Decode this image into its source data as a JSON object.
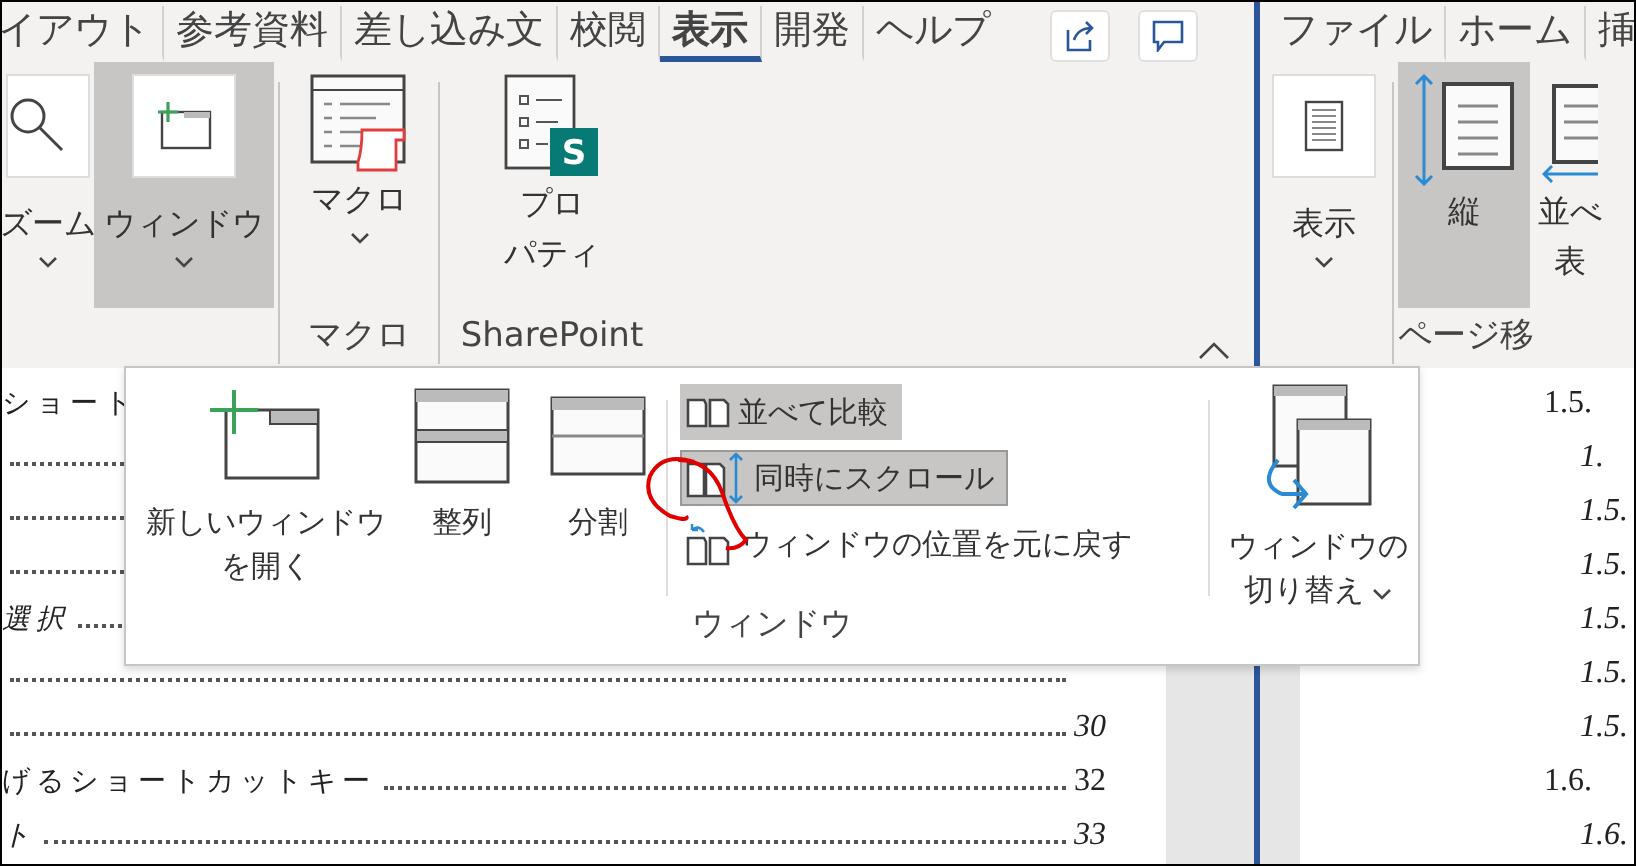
{
  "left_window": {
    "tabs": [
      {
        "label": "イアウト",
        "selected": false
      },
      {
        "label": "参考資料",
        "selected": false
      },
      {
        "label": "差し込み文",
        "selected": false
      },
      {
        "label": "校閲",
        "selected": false
      },
      {
        "label": "表示",
        "selected": true
      },
      {
        "label": "開発",
        "selected": false
      },
      {
        "label": "ヘルプ",
        "selected": false
      }
    ],
    "ribbon": {
      "buttons": [
        {
          "kind": "zoom",
          "lines": [
            "ズーム"
          ],
          "selected": false,
          "dropdown": true
        },
        {
          "kind": "window",
          "lines": [
            "ウィンドウ"
          ],
          "selected": true,
          "dropdown": true
        },
        {
          "kind": "macro",
          "lines": [
            "マクロ"
          ],
          "selected": false,
          "dropdown": true
        },
        {
          "kind": "properties",
          "lines": [
            "プロ",
            "パティ"
          ],
          "badge": "S",
          "selected": false,
          "dropdown": false
        }
      ],
      "groups": [
        "マクロ",
        "SharePoint"
      ]
    },
    "document": {
      "rows": [
        {
          "text": "ショート",
          "italic": false
        },
        {},
        {},
        {},
        {
          "text": "選択",
          "italic": true
        },
        {},
        {
          "page": "30",
          "italic": true
        },
        {
          "text": "げるショートカットキー",
          "page": "32",
          "italic": false
        },
        {
          "text": "ト",
          "page": "33",
          "italic": true
        }
      ]
    }
  },
  "window_menu": {
    "large_buttons": [
      {
        "kind": "new-window",
        "lines": [
          "新しいウィンドウ",
          "を開く"
        ]
      },
      {
        "kind": "arrange",
        "lines": [
          "整列"
        ]
      },
      {
        "kind": "split",
        "lines": [
          "分割"
        ]
      }
    ],
    "small_buttons": [
      {
        "kind": "side-by-side",
        "label": "並べて比較",
        "selected": true
      },
      {
        "kind": "sync-scroll",
        "label": "同時にスクロール",
        "selected": true
      },
      {
        "kind": "reset-position",
        "label": "ウィンドウの位置を元に戻す",
        "selected": false
      }
    ],
    "switch_button": {
      "lines": [
        "ウィンドウの",
        "切り替え"
      ]
    },
    "group_label": "ウィンドウ"
  },
  "right_window": {
    "tabs": [
      {
        "label": "ファイル",
        "selected": false
      },
      {
        "label": "ホーム",
        "selected": false
      },
      {
        "label": "挿",
        "selected": false
      }
    ],
    "ribbon": {
      "buttons": [
        {
          "kind": "display",
          "lines": [
            "表示"
          ],
          "selected": false,
          "dropdown": true
        },
        {
          "kind": "vertical",
          "lines": [
            "縦"
          ],
          "selected": true,
          "dropdown": false
        },
        {
          "kind": "side-by-side",
          "lines": [
            "並べ",
            "表"
          ],
          "selected": false,
          "dropdown": false
        }
      ],
      "groups": [
        "ページ移"
      ]
    },
    "document": {
      "rows": [
        {
          "text": "1.5.",
          "kind": "heading"
        },
        {
          "text": "1.",
          "kind": "sub"
        },
        {
          "text": "1.5.",
          "kind": "sub"
        },
        {
          "text": "1.5.",
          "kind": "sub"
        },
        {
          "text": "1.5.",
          "kind": "sub"
        },
        {
          "text": "1.5.",
          "kind": "sub"
        },
        {
          "text": "1.5.",
          "kind": "sub"
        },
        {
          "text": "1.6.",
          "kind": "heading"
        },
        {
          "text": "1.6.",
          "kind": "sub"
        }
      ]
    }
  }
}
